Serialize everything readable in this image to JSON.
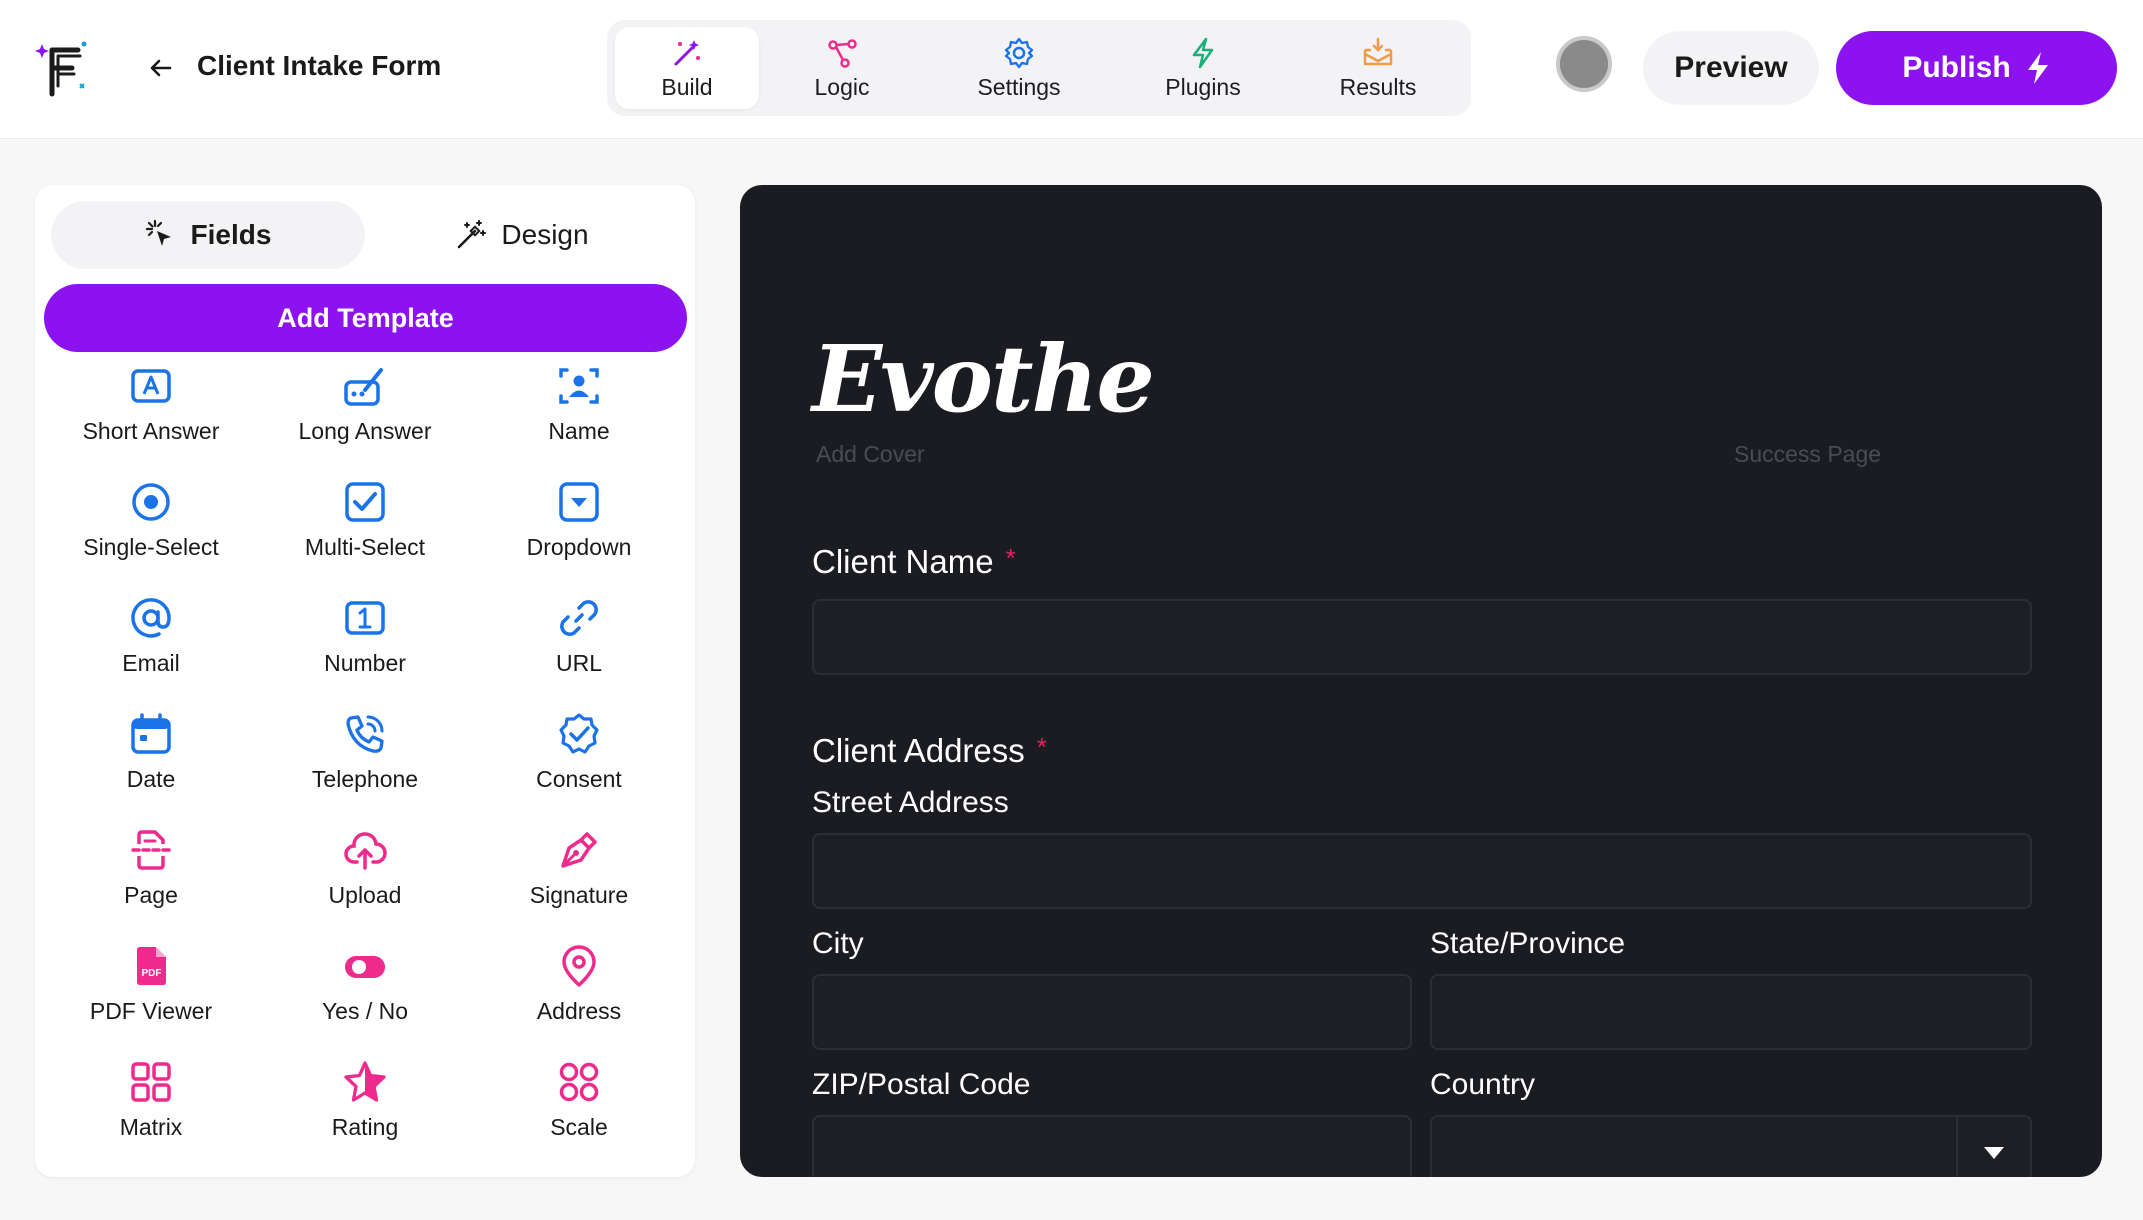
{
  "header": {
    "form_title": "Client Intake Form",
    "nav": [
      {
        "label": "Build",
        "icon": "magic-wand-icon",
        "active": true
      },
      {
        "label": "Logic",
        "icon": "logic-branch-icon",
        "active": false
      },
      {
        "label": "Settings",
        "icon": "gear-icon",
        "active": false
      },
      {
        "label": "Plugins",
        "icon": "bolt-icon",
        "active": false
      },
      {
        "label": "Results",
        "icon": "inbox-icon",
        "active": false
      }
    ],
    "preview_label": "Preview",
    "publish_label": "Publish"
  },
  "sidebar": {
    "tabs": [
      {
        "label": "Fields",
        "icon": "pointer-click-icon",
        "active": true
      },
      {
        "label": "Design",
        "icon": "magic-wand-icon",
        "active": false
      }
    ],
    "add_template_label": "Add Template",
    "fields": [
      {
        "label": "Short Answer",
        "icon": "short-answer-icon",
        "color": "#1a73e8"
      },
      {
        "label": "Long Answer",
        "icon": "long-answer-icon",
        "color": "#1a73e8"
      },
      {
        "label": "Name",
        "icon": "name-icon",
        "color": "#1a73e8"
      },
      {
        "label": "Single-Select",
        "icon": "radio-icon",
        "color": "#1a73e8"
      },
      {
        "label": "Multi-Select",
        "icon": "checkbox-icon",
        "color": "#1a73e8"
      },
      {
        "label": "Dropdown",
        "icon": "dropdown-icon",
        "color": "#1a73e8"
      },
      {
        "label": "Email",
        "icon": "at-icon",
        "color": "#1a73e8"
      },
      {
        "label": "Number",
        "icon": "number-icon",
        "color": "#1a73e8"
      },
      {
        "label": "URL",
        "icon": "link-icon",
        "color": "#1a73e8"
      },
      {
        "label": "Date",
        "icon": "calendar-icon",
        "color": "#1a73e8"
      },
      {
        "label": "Telephone",
        "icon": "phone-icon",
        "color": "#1a73e8"
      },
      {
        "label": "Consent",
        "icon": "verified-icon",
        "color": "#1a73e8"
      },
      {
        "label": "Page",
        "icon": "page-icon",
        "color": "#ee2a8c"
      },
      {
        "label": "Upload",
        "icon": "upload-cloud-icon",
        "color": "#ee2a8c"
      },
      {
        "label": "Signature",
        "icon": "pen-nib-icon",
        "color": "#ee2a8c"
      },
      {
        "label": "PDF Viewer",
        "icon": "pdf-icon",
        "color": "#ee2a8c"
      },
      {
        "label": "Yes / No",
        "icon": "toggle-icon",
        "color": "#ee2a8c"
      },
      {
        "label": "Address",
        "icon": "map-pin-icon",
        "color": "#ee2a8c"
      },
      {
        "label": "Matrix",
        "icon": "grid-icon",
        "color": "#ee2a8c"
      },
      {
        "label": "Rating",
        "icon": "star-icon",
        "color": "#ee2a8c"
      },
      {
        "label": "Scale",
        "icon": "scale-dots-icon",
        "color": "#ee2a8c"
      }
    ]
  },
  "canvas": {
    "brand": "Evothe",
    "add_cover": "Add Cover",
    "success_page": "Success Page",
    "client_name_label": "Client Name",
    "client_address_label": "Client Address",
    "required_mark": "*",
    "street_label": "Street Address",
    "city_label": "City",
    "state_label": "State/Province",
    "zip_label": "ZIP/Postal Code",
    "country_label": "Country"
  },
  "colors": {
    "accent": "#8c12f0",
    "field_icon_blue": "#1a73e8",
    "field_icon_pink": "#ee2a8c",
    "canvas_bg": "#1b1c22",
    "required": "#e0245e"
  }
}
